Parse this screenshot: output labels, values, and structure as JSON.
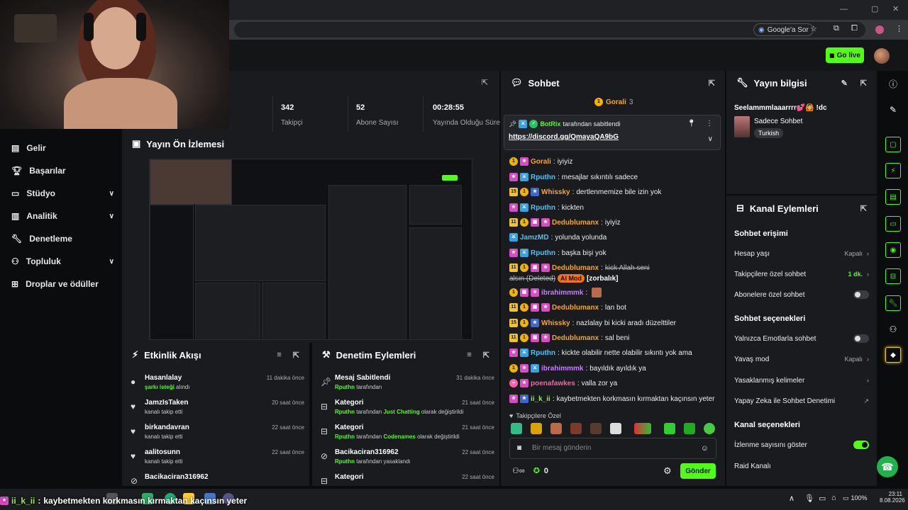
{
  "browser": {
    "google_ask": "Google'a Sor"
  },
  "header": {
    "go_live": "Go live"
  },
  "sidebar": {
    "items": [
      {
        "label": "Gelir",
        "icon": "wallet-icon"
      },
      {
        "label": "Başarılar",
        "icon": "trophy-icon"
      },
      {
        "label": "Stüdyo",
        "icon": "studio-icon"
      },
      {
        "label": "Analitik",
        "icon": "chart-icon"
      },
      {
        "label": "Denetleme",
        "icon": "wrench-icon"
      },
      {
        "label": "Topluluk",
        "icon": "community-icon"
      },
      {
        "label": "Droplar ve ödüller",
        "icon": "drops-icon"
      }
    ]
  },
  "stats": [
    {
      "value": "342",
      "label": "Takipçi"
    },
    {
      "value": "52",
      "label": "Abone Sayısı"
    },
    {
      "value": "00:28:55",
      "label": "Yayında Olduğu Süre"
    }
  ],
  "preview": {
    "title": "Yayın Ön İzlemesi"
  },
  "events": {
    "title": "Etkinlik Akışı",
    "rows": [
      {
        "name": "Hasanlalay",
        "pre": "",
        "highlight": "şarkı isteği",
        "post": " alındı",
        "time": "11 dakika önce"
      },
      {
        "name": "JamzIsTaken",
        "pre": "kanalı takip etti",
        "highlight": "",
        "post": "",
        "time": "20 saat önce"
      },
      {
        "name": "birkandavran",
        "pre": "kanalı takip etti",
        "highlight": "",
        "post": "",
        "time": "22 saat önce"
      },
      {
        "name": "aalitosunn",
        "pre": "kanalı takip etti",
        "highlight": "",
        "post": "",
        "time": "22 saat önce"
      },
      {
        "name": "Bacikaciran316962",
        "pre": "",
        "highlight": "",
        "post": "",
        "time": ""
      }
    ]
  },
  "mod_actions": {
    "title": "Denetim Eylemleri",
    "rows": [
      {
        "name": "Mesaj Sabitlendi",
        "who": "Rputhn",
        "pre": " tarafından",
        "highlight": "",
        "post": "",
        "time": "31 dakika önce"
      },
      {
        "name": "Kategori",
        "who": "Rputhn",
        "pre": " tarafından ",
        "highlight": "Just Chatting",
        "post": " olarak değiştirildi",
        "time": "21 saat önce"
      },
      {
        "name": "Kategori",
        "who": "Rputhn",
        "pre": " tarafından ",
        "highlight": "Codenames",
        "post": " olarak değiştirildi",
        "time": "21 saat önce"
      },
      {
        "name": "Bacikaciran316962",
        "who": "Rputhn",
        "pre": " tarafından yasaklandı",
        "highlight": "",
        "post": "",
        "time": "22 saat önce"
      },
      {
        "name": "Kategori",
        "who": "",
        "pre": "",
        "highlight": "",
        "post": "",
        "time": "22 saat önce"
      }
    ]
  },
  "chat": {
    "title": "Sohbet",
    "gifter": "Gorali",
    "gifter_count": "3",
    "pinned_by": "BotRix",
    "pinned_suffix": " tarafından sabitlendi",
    "pinned_link": "https://discord.gg/QmayaQA9bG",
    "messages": [
      {
        "badges": [
          "gift",
          "vip"
        ],
        "user": "Gorali",
        "color": "#f5a623",
        "text": "iyiyiz",
        "strike": false
      },
      {
        "badges": [
          "vip",
          "mod"
        ],
        "user": "Rputhn",
        "color": "#4fc3f7",
        "text": "mesajlar sıkıntılı sadece",
        "strike": false
      },
      {
        "badges": [
          "sub15",
          "gift",
          "og"
        ],
        "user": "Whissky",
        "color": "#f5a623",
        "text": "dertlenmemize bile izin yok",
        "strike": false
      },
      {
        "badges": [
          "vip",
          "mod"
        ],
        "user": "Rputhn",
        "color": "#4fc3f7",
        "text": "kickten",
        "strike": false
      },
      {
        "badges": [
          "sub11",
          "gift",
          "sub",
          "vip"
        ],
        "user": "Dedublumanx",
        "color": "#f5a623",
        "text": "iyiyiz",
        "strike": false
      },
      {
        "badges": [
          "mod"
        ],
        "user": "JamzMD",
        "color": "#4fc3f7",
        "text": "yolunda yolunda",
        "strike": false
      },
      {
        "badges": [
          "vip",
          "mod"
        ],
        "user": "Rputhn",
        "color": "#4fc3f7",
        "text": "başka bişi yok",
        "strike": false
      },
      {
        "badges": [
          "sub11",
          "gift",
          "sub",
          "vip"
        ],
        "user": "Dedublumanx",
        "color": "#f5a623",
        "text": "kick Allah seni",
        "strike": true
      },
      {
        "badges": [
          "gift",
          "sub",
          "vip"
        ],
        "user": "ibrahimmmk",
        "color": "#c77dff",
        "text": "",
        "strike": false
      },
      {
        "badges": [
          "sub11",
          "gift",
          "sub",
          "vip"
        ],
        "user": "Dedublumanx",
        "color": "#f5a623",
        "text": "lan bot",
        "strike": false
      },
      {
        "badges": [
          "sub15",
          "gift",
          "og"
        ],
        "user": "Whissky",
        "color": "#f5a623",
        "text": "nazlalay bi kicki aradı düzelttiler",
        "strike": false
      },
      {
        "badges": [
          "sub11",
          "gift",
          "sub",
          "vip"
        ],
        "user": "Dedublumanx",
        "color": "#f5a623",
        "text": "sal beni",
        "strike": false
      },
      {
        "badges": [
          "vip",
          "mod"
        ],
        "user": "Rputhn",
        "color": "#4fc3f7",
        "text": "kickte olabilir nette olabilir sıkıntı yok ama",
        "strike": false
      },
      {
        "badges": [
          "gift",
          "vip",
          "mod"
        ],
        "user": "ibrahimmmk",
        "color": "#c77dff",
        "text": "bayıldık ayıldık ya",
        "strike": false
      },
      {
        "badges": [
          "pink",
          "vip"
        ],
        "user": "poenafawkes",
        "color": "#ff5fa8",
        "text": "valla zor ya",
        "strike": false
      },
      {
        "badges": [
          "vip",
          "og"
        ],
        "user": "ii_k_ii",
        "color": "#9be564",
        "text": "kaybetmekten korkmasın kırmaktan kaçınsın yeter",
        "strike": false
      }
    ],
    "deleted_line": {
      "pre": "alsın (Deleted)",
      "tag": "AI Mod",
      "post": "[zorbalık]"
    },
    "followers_only": "Takipçilere Özel",
    "placeholder": "Bir mesaj gönderin",
    "points": "0",
    "send": "Gönder"
  },
  "stream_info": {
    "title": "Yayın bilgisi",
    "stream_title": "Seelammmlaaarrrr💕🙆 !dc",
    "category": "Sadece Sohbet",
    "language": "Turkish"
  },
  "channel_actions": {
    "title": "Kanal Eylemleri",
    "chat_access": "Sohbet erişimi",
    "account_age": "Hesap yaşı",
    "account_age_val": "Kapalı",
    "followers_chat": "Takipçilere özel sohbet",
    "followers_chat_val": "1 dk.",
    "subs_chat": "Abonelere özel sohbet",
    "chat_options": "Sohbet seçenekleri",
    "emote_only": "Yalnızca Emotlarla sohbet",
    "slow_mode": "Yavaş mod",
    "slow_mode_val": "Kapalı",
    "banned_words": "Yasaklanmış kelimeler",
    "ai_mod": "Yapay Zeka ile Sohbet Denetimi",
    "channel_options": "Kanal seçenekleri",
    "show_viewers": "İzlenme sayısını göster",
    "raid": "Raid Kanalı"
  },
  "overlay": {
    "user": "ii_k_ii",
    "text": "kaybetmekten korkmasın kırmaktan kaçınsın yeter"
  },
  "taskbar": {
    "battery": "100%",
    "time": "23:11",
    "date": "8.08.2026"
  },
  "colors": {
    "accent": "#53fc18",
    "panel": "#191b1f",
    "bg": "#0b0c0e"
  }
}
